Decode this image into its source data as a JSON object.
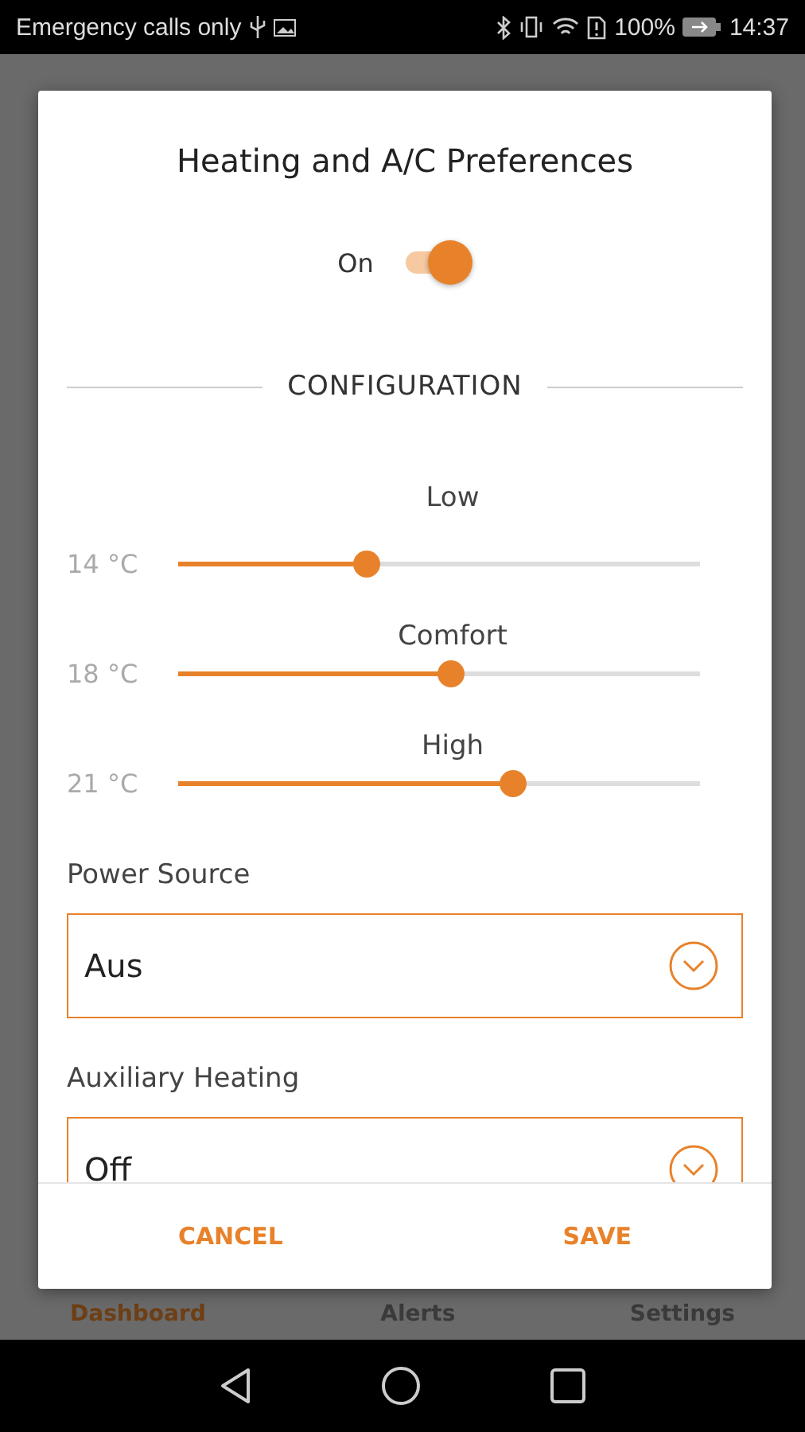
{
  "status_bar": {
    "carrier": "Emergency calls only",
    "battery": "100%",
    "time": "14:37"
  },
  "dialog": {
    "title": "Heating and A/C Preferences",
    "toggle": {
      "label": "On",
      "on": true
    },
    "section": "CONFIGURATION",
    "sliders": [
      {
        "name": "Low",
        "reading": "14 °C",
        "level": 0.36
      },
      {
        "name": "Comfort",
        "reading": "18 °C",
        "level": 0.52
      },
      {
        "name": "High",
        "reading": "21 °C",
        "level": 0.64
      }
    ],
    "fields": [
      {
        "label": "Power Source",
        "value": "Aus"
      },
      {
        "label": "Auxiliary Heating",
        "value": "Off"
      }
    ],
    "buttons": [
      "CANCEL",
      "SAVE"
    ]
  },
  "bottom_nav": [
    {
      "label": "Dashboard",
      "selected": true
    },
    {
      "label": "Alerts",
      "selected": false
    },
    {
      "label": "Settings",
      "selected": false
    }
  ]
}
